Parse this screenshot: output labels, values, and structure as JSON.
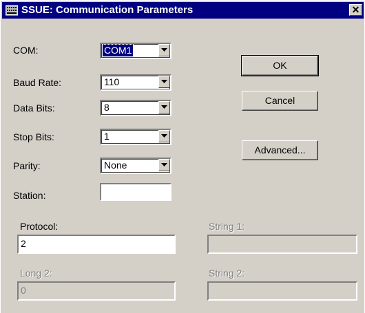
{
  "window": {
    "title": "SSUE: Communication Parameters",
    "close_glyph": "✕"
  },
  "fields": {
    "com": {
      "label": "COM:",
      "value": "COM1"
    },
    "baud_rate": {
      "label": "Baud Rate:",
      "value": "110"
    },
    "data_bits": {
      "label": "Data Bits:",
      "value": "8"
    },
    "stop_bits": {
      "label": "Stop Bits:",
      "value": "1"
    },
    "parity": {
      "label": "Parity:",
      "value": "None"
    },
    "station": {
      "label": "Station:",
      "value": ""
    }
  },
  "params": {
    "protocol": {
      "label": "Protocol:",
      "value": "2"
    },
    "string1": {
      "label": "String 1:",
      "value": ""
    },
    "long2": {
      "label": "Long 2:",
      "value": "0"
    },
    "string2": {
      "label": "String 2:",
      "value": ""
    }
  },
  "buttons": {
    "ok": "OK",
    "cancel": "Cancel",
    "advanced": "Advanced..."
  },
  "colors": {
    "titlebar": "#000080",
    "face": "#d4d0c8",
    "disabled_text": "#808080"
  },
  "icons": {
    "app": "keyboard-app-icon",
    "dropdown": "chevron-down-icon",
    "close": "close-icon"
  }
}
